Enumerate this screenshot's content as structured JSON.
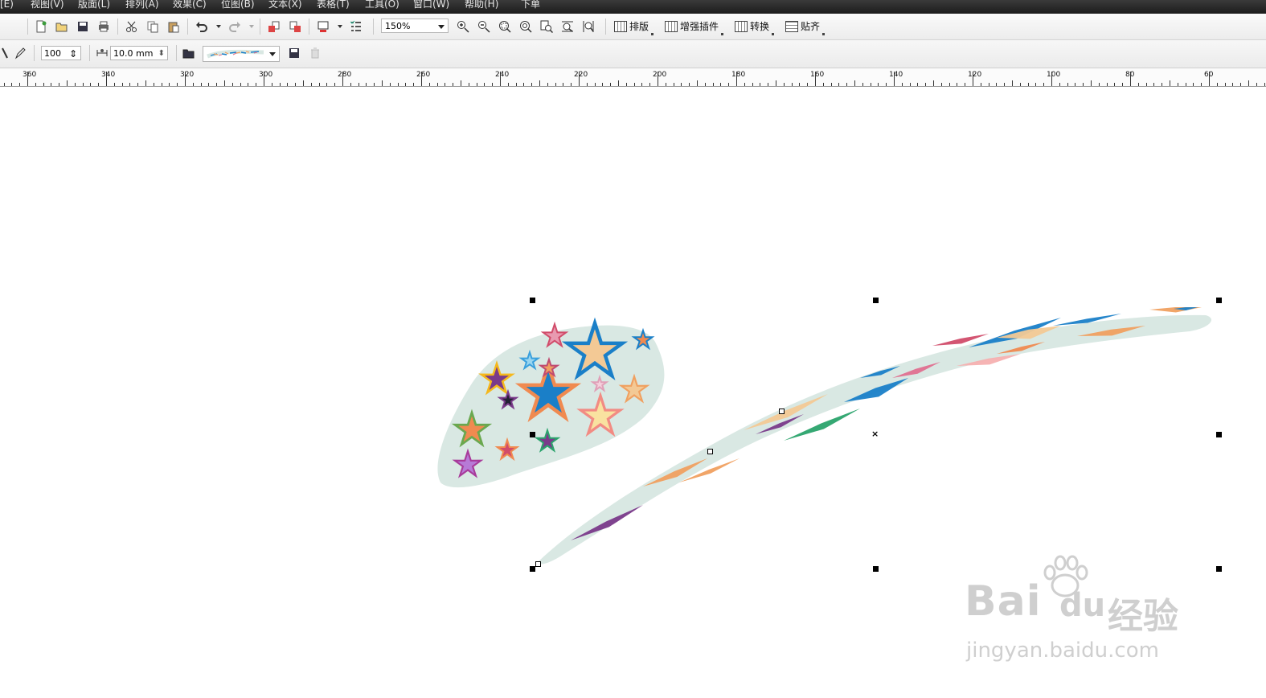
{
  "menu": {
    "items": [
      "[E)",
      "视图(V)",
      "版面(L)",
      "排列(A)",
      "效果(C)",
      "位图(B)",
      "文本(X)",
      "表格(T)",
      "工具(O)",
      "窗口(W)",
      "帮助(H)",
      "下单"
    ]
  },
  "toolbar": {
    "zoom_value": "150%",
    "plugins": [
      "排版",
      "增强插件",
      "转换",
      "贴齐"
    ],
    "icons": [
      "new-doc-icon",
      "open-icon",
      "save-icon",
      "print-icon",
      "cut-icon",
      "copy-icon",
      "paste-icon",
      "undo-icon",
      "redo-icon",
      "import-icon",
      "export-icon",
      "app-launcher-icon",
      "options-icon",
      "zoom-in-icon",
      "zoom-out-icon",
      "zoom-selected-icon",
      "zoom-all-icon",
      "zoom-page-icon",
      "zoom-width-icon",
      "zoom-height-icon"
    ]
  },
  "property_bar": {
    "size_value": "100",
    "spacing_value": "10.0 mm",
    "icons": [
      "pen-tool-icon",
      "spray-icon",
      "folder-icon",
      "save-spraylist-icon",
      "delete-icon"
    ]
  },
  "ruler": {
    "labels": [
      "360",
      "340",
      "320",
      "300",
      "280",
      "260",
      "240",
      "220",
      "200",
      "180",
      "160",
      "140",
      "120",
      "100",
      "80",
      "60"
    ]
  },
  "colors": {
    "shape_fill": "#d9e8e3",
    "blue": "#1a7fc8",
    "orange": "#f0a060",
    "purple": "#7a3a8a",
    "pink": "#e07090"
  },
  "watermark": {
    "brand": "Bai",
    "brand2": "du",
    "cn": "经验",
    "url": "jingyan.baidu.com"
  }
}
